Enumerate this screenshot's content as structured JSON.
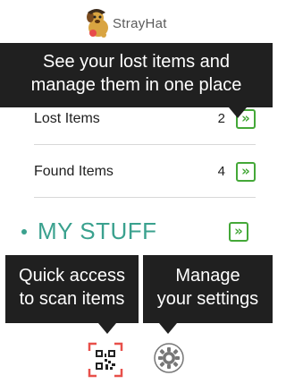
{
  "app": {
    "logo_text": "StrayHat"
  },
  "tooltips": {
    "top_line1": "See your lost items and",
    "top_line2": "manage them in one place",
    "left_line1": "Quick access",
    "left_line2": "to scan items",
    "right_line1": "Manage",
    "right_line2": "your settings"
  },
  "list": {
    "items": [
      {
        "label": "Lost Items",
        "count": "2"
      },
      {
        "label": "Found Items",
        "count": "4"
      }
    ]
  },
  "my_stuff": {
    "label": "MY STUFF"
  },
  "icons": {
    "chevron": "double-chevron-right-icon",
    "qr": "qr-scan-icon",
    "settings": "gear-icon"
  },
  "colors": {
    "accent_green": "#44a838",
    "teal": "#3aa18e",
    "qr_red": "#e8504a",
    "tooltip_bg": "#202020"
  }
}
